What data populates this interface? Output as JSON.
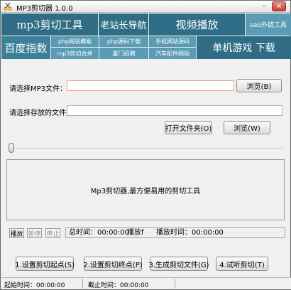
{
  "window": {
    "title": "MP3剪切器 1.0.0",
    "min_glyph": "–",
    "close_glyph": "✕"
  },
  "banner": {
    "row1": [
      "mp3剪切工具",
      "老站长导航",
      "视频播放",
      "seo外链工具"
    ],
    "row2_left": "百度指数",
    "links": [
      "php网站模板",
      "php源码下载",
      "手机网站源码",
      "mp3剪切合并",
      "厦门招聘",
      "汽车配件网站"
    ],
    "row2_right": "单机游戏 下载"
  },
  "form": {
    "mp3_label": "请选择MP3文件：",
    "mp3_value": "",
    "browse1": "浏览(B)",
    "save_label": "请选择存放的文件夹：",
    "save_value": "",
    "open_folder": "打开文件夹(O)",
    "browse2": "浏览(W)"
  },
  "slider": {
    "position": 0
  },
  "panel": {
    "text": "Mp3剪切器,最方便易用的剪切工具"
  },
  "playback": {
    "play": "播放",
    "pause": "暂停",
    "stop": "停止",
    "total_time": "总时间：00:00:00",
    "play_status": "播放f",
    "play_time": "播放时间：00:00:00"
  },
  "actions": [
    "1.设置剪切起点(S)",
    "2.设置剪切终点(P)",
    "3.生成剪切文件(G)",
    "4.试听剪切(T)"
  ],
  "status": {
    "start": "起始时间：00:00:00",
    "end": "截止时间：00:00:00"
  }
}
